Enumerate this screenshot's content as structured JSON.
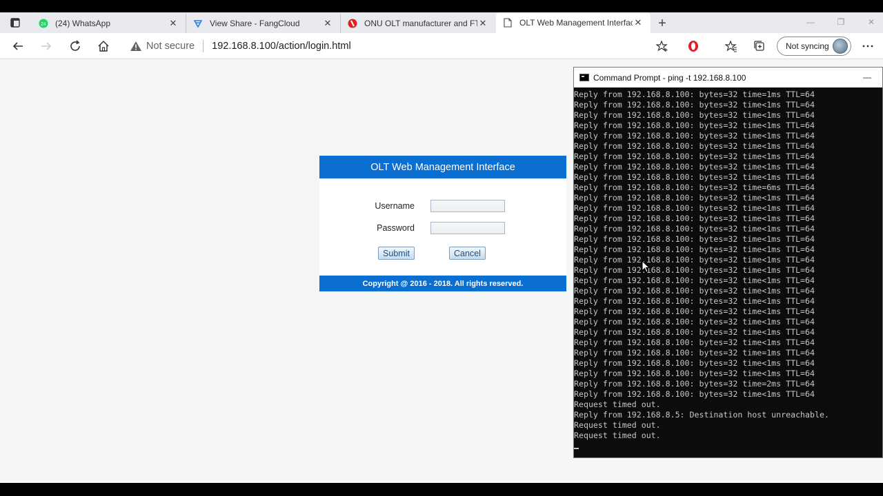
{
  "tabs": [
    {
      "title": "(24) WhatsApp",
      "badge": "24",
      "close": "✕"
    },
    {
      "title": "View Share - FangCloud",
      "close": "✕"
    },
    {
      "title": "ONU OLT manufacturer and FTTx",
      "close": "✕"
    },
    {
      "title": "OLT Web Management Interface",
      "close": "✕",
      "active": true
    }
  ],
  "toolbar": {
    "security_label": "Not secure",
    "url": "192.168.8.100/action/login.html",
    "sync_label": "Not syncing"
  },
  "login": {
    "heading": "OLT Web Management Interface",
    "username_label": "Username",
    "password_label": "Password",
    "submit_label": "Submit",
    "cancel_label": "Cancel",
    "footer": "Copyright @ 2016 - 2018. All rights reserved.",
    "header_color": "#0a6fd1"
  },
  "cmd": {
    "title": "Command Prompt - ping  -t 192.168.8.100",
    "lines": [
      "Reply from 192.168.8.100: bytes=32 time=1ms TTL=64",
      "Reply from 192.168.8.100: bytes=32 time<1ms TTL=64",
      "Reply from 192.168.8.100: bytes=32 time<1ms TTL=64",
      "Reply from 192.168.8.100: bytes=32 time<1ms TTL=64",
      "Reply from 192.168.8.100: bytes=32 time<1ms TTL=64",
      "Reply from 192.168.8.100: bytes=32 time<1ms TTL=64",
      "Reply from 192.168.8.100: bytes=32 time<1ms TTL=64",
      "Reply from 192.168.8.100: bytes=32 time<1ms TTL=64",
      "Reply from 192.168.8.100: bytes=32 time<1ms TTL=64",
      "Reply from 192.168.8.100: bytes=32 time=6ms TTL=64",
      "Reply from 192.168.8.100: bytes=32 time<1ms TTL=64",
      "Reply from 192.168.8.100: bytes=32 time<1ms TTL=64",
      "Reply from 192.168.8.100: bytes=32 time<1ms TTL=64",
      "Reply from 192.168.8.100: bytes=32 time<1ms TTL=64",
      "Reply from 192.168.8.100: bytes=32 time<1ms TTL=64",
      "Reply from 192.168.8.100: bytes=32 time<1ms TTL=64",
      "Reply from 192.168.8.100: bytes=32 time<1ms TTL=64",
      "Reply from 192.168.8.100: bytes=32 time<1ms TTL=64",
      "Reply from 192.168.8.100: bytes=32 time<1ms TTL=64",
      "Reply from 192.168.8.100: bytes=32 time<1ms TTL=64",
      "Reply from 192.168.8.100: bytes=32 time<1ms TTL=64",
      "Reply from 192.168.8.100: bytes=32 time<1ms TTL=64",
      "Reply from 192.168.8.100: bytes=32 time<1ms TTL=64",
      "Reply from 192.168.8.100: bytes=32 time<1ms TTL=64",
      "Reply from 192.168.8.100: bytes=32 time<1ms TTL=64",
      "Reply from 192.168.8.100: bytes=32 time=1ms TTL=64",
      "Reply from 192.168.8.100: bytes=32 time<1ms TTL=64",
      "Reply from 192.168.8.100: bytes=32 time<1ms TTL=64",
      "Reply from 192.168.8.100: bytes=32 time=2ms TTL=64",
      "Reply from 192.168.8.100: bytes=32 time<1ms TTL=64",
      "Request timed out.",
      "Reply from 192.168.8.5: Destination host unreachable.",
      "Request timed out.",
      "Request timed out."
    ]
  }
}
